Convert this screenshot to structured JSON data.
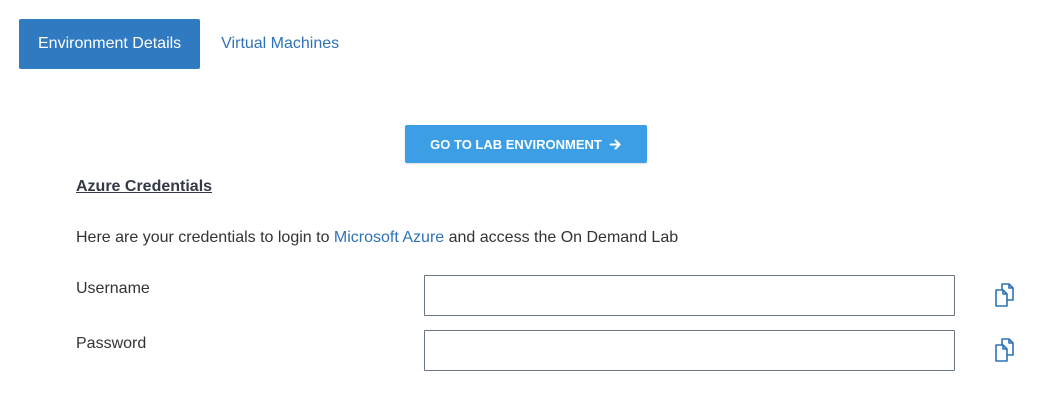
{
  "tabs": [
    {
      "label": "Environment Details",
      "active": true
    },
    {
      "label": "Virtual Machines",
      "active": false
    }
  ],
  "actions": {
    "go_to_lab_label": "GO TO LAB ENVIRONMENT",
    "go_to_lab_icon": "arrow-right-icon"
  },
  "credentials": {
    "title": "Azure Credentials",
    "intro_before": "Here are your credentials to login to ",
    "intro_link": "Microsoft Azure",
    "intro_after": " and access the On Demand Lab",
    "username_label": "Username",
    "username_value": "",
    "password_label": "Password",
    "password_value": "",
    "copy_icon": "copy-icon"
  },
  "colors": {
    "primary": "#2f7ac0",
    "button": "#3c9ee5",
    "link": "#2f72b6"
  }
}
